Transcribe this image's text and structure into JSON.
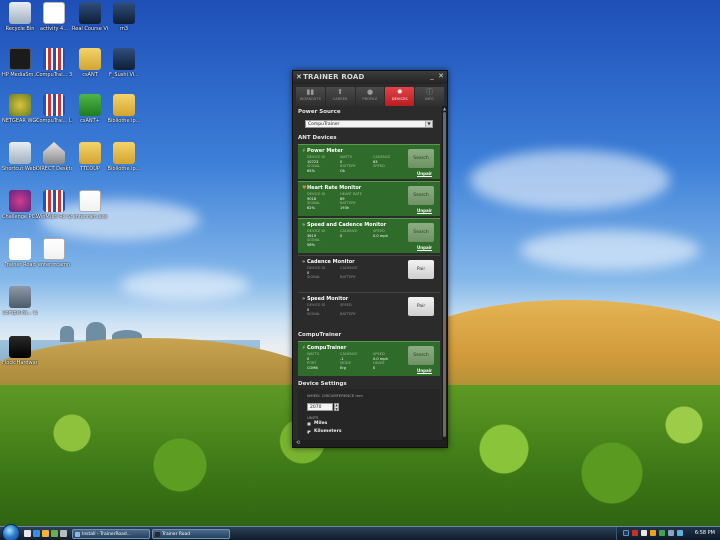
{
  "desktop": {
    "icons": [
      {
        "label": "Recycle Bin",
        "icon": "recycle-bin-icon"
      },
      {
        "label": "activity 4...",
        "icon": "document-icon"
      },
      {
        "label": "Real Course Video",
        "icon": "video-icon"
      },
      {
        "label": "m3",
        "icon": "media-icon"
      },
      {
        "label": "HP MediaSm...",
        "icon": "hp-app-icon"
      },
      {
        "label": "CompuTrai... 3D",
        "icon": "computrainer-icon"
      },
      {
        "label": "csANT",
        "icon": "folder-icon"
      },
      {
        "label": "F_Sushi Vi...",
        "icon": "media-icon"
      },
      {
        "label": "NETGEAR WG111v3 S...",
        "icon": "netgear-icon"
      },
      {
        "label": "CompuTrai... Lesson TC...",
        "icon": "computrainer-icon"
      },
      {
        "label": "csANT+",
        "icon": "check-folder-icon"
      },
      {
        "label": "Bibliothe ip...",
        "icon": "folder-icon"
      },
      {
        "label": "Shortcut Webcam ...",
        "icon": "shortcut-icon"
      },
      {
        "label": "DIRECT Desktop",
        "icon": "house-icon"
      },
      {
        "label": "TTCOUP",
        "icon": "folder-icon"
      },
      {
        "label": "Bibliothe ip...",
        "icon": "folder-icon"
      },
      {
        "label": "Challenge PC1",
        "icon": "disc-icon"
      },
      {
        "label": "WinMulti Rx Stuff Trainer",
        "icon": "computrainer-icon"
      },
      {
        "label": "enter.rain.exe",
        "icon": "rv-app-icon"
      },
      {
        "label": "Trainer Road",
        "icon": "trainer-road-icon"
      },
      {
        "label": "enter.rrcamn",
        "icon": "rv-app-icon"
      },
      {
        "label": "CompuTra... CS 5.0",
        "icon": "bike-icon"
      },
      {
        "label": "Flock Hardware...",
        "icon": "music-app-icon"
      }
    ]
  },
  "trainerroad": {
    "title": "TRAINER ROAD",
    "minimize": "_",
    "close": "✕",
    "tabs": [
      {
        "label": "WORKOUTS",
        "icon": "bar-chart-icon",
        "active": false
      },
      {
        "label": "CAREER",
        "icon": "arrow-up-icon",
        "active": false
      },
      {
        "label": "PROFILE",
        "icon": "person-icon",
        "active": false
      },
      {
        "label": "DEVICES",
        "icon": "gear-icon",
        "active": true
      },
      {
        "label": "INFO",
        "icon": "info-icon",
        "active": false
      }
    ],
    "power_source": {
      "heading": "Power Source",
      "selected": "CompuTrainer"
    },
    "ant_heading": "ANT Devices",
    "ant_devices": [
      {
        "name": "Power Meter",
        "icon": "lightning-icon",
        "status": "connected",
        "stats": [
          [
            "DEVICE ID",
            "10723"
          ],
          [
            "WATTS",
            "0"
          ],
          [
            "CADENCE",
            "63"
          ],
          [
            "SIGNAL",
            "65%"
          ],
          [
            "BATTERY",
            "Ok"
          ],
          [
            "SPEED",
            ""
          ]
        ],
        "action": "Search",
        "unpair": "Unpair"
      },
      {
        "name": "Heart Rate Monitor",
        "icon": "heart-icon",
        "status": "connected",
        "stats": [
          [
            "DEVICE ID",
            "9018"
          ],
          [
            "HEART RATE",
            "69"
          ],
          [
            "",
            ""
          ],
          [
            "SIGNAL",
            "62%"
          ],
          [
            "BATTERY",
            "193h"
          ],
          [
            "",
            ""
          ]
        ],
        "action": "Search",
        "unpair": "Unpair"
      },
      {
        "name": "Speed and Cadence Monitor",
        "icon": "chevrons-icon",
        "status": "connected",
        "stats": [
          [
            "DEVICE ID",
            "3619"
          ],
          [
            "CADENCE",
            "0"
          ],
          [
            "SPEED",
            "0.0 mph"
          ],
          [
            "SIGNAL",
            "56%"
          ],
          [
            "",
            ""
          ],
          [
            "",
            ""
          ]
        ],
        "action": "Search",
        "unpair": "Unpair"
      },
      {
        "name": "Cadence Monitor",
        "icon": "chevrons-icon",
        "status": "disconnected",
        "stats": [
          [
            "DEVICE ID",
            "0"
          ],
          [
            "CADENCE",
            ""
          ],
          [
            "",
            ""
          ],
          [
            "SIGNAL",
            ""
          ],
          [
            "BATTERY",
            ""
          ],
          [
            "",
            ""
          ]
        ],
        "action": "Pair",
        "unpair": ""
      },
      {
        "name": "Speed Monitor",
        "icon": "chevrons-icon",
        "status": "disconnected",
        "stats": [
          [
            "DEVICE ID",
            "0"
          ],
          [
            "SPEED",
            ""
          ],
          [
            "",
            ""
          ],
          [
            "SIGNAL",
            ""
          ],
          [
            "BATTERY",
            ""
          ],
          [
            "",
            ""
          ]
        ],
        "action": "Pair",
        "unpair": ""
      }
    ],
    "computrainer_heading": "CompuTrainer",
    "computrainer": {
      "name": "CompuTrainer",
      "icon": "lightning-icon",
      "status": "connected",
      "stats": [
        [
          "WATTS",
          "0"
        ],
        [
          "CADENCE",
          "-1"
        ],
        [
          "SPEED",
          "0.0 mph"
        ],
        [
          "PORT",
          "COM6"
        ],
        [
          "MODE",
          "Erg"
        ],
        [
          "HEART",
          "0"
        ]
      ],
      "action": "Search",
      "unpair": "Unpair"
    },
    "settings": {
      "heading": "Device Settings",
      "wheel_label": "WHEEL CIRCUMFERENCE mm",
      "wheel_value": "2070",
      "units_label": "UNITS",
      "units": [
        {
          "label": "Miles",
          "selected": false
        },
        {
          "label": "Kilometers",
          "selected": true
        }
      ]
    }
  },
  "taskbar": {
    "tasks": [
      {
        "label": "Install - TrainerRoad...",
        "icon": "explorer-icon"
      },
      {
        "label": "Trainer Road",
        "icon": "trainer-road-icon"
      }
    ],
    "clock": "6:58 PM"
  },
  "colors": {
    "accent_red": "#d3282d",
    "connected_green": "#2f6b2a",
    "panel_dark": "#2b2b2b"
  }
}
